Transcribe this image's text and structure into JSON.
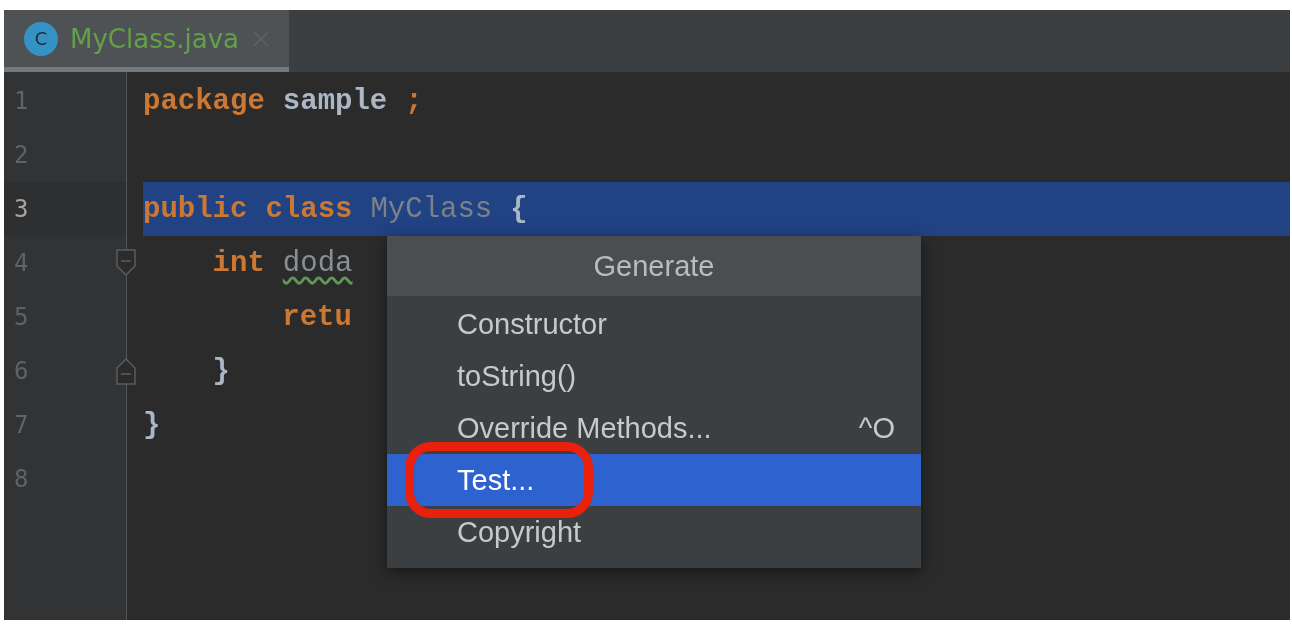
{
  "tabs": [
    {
      "icon_letter": "C",
      "label": "MyClass.java",
      "selected": true
    }
  ],
  "editor": {
    "lines": [
      {
        "number": "1",
        "selected": false,
        "fold_open": false,
        "fold_close": false,
        "tokens": [
          {
            "text": "package",
            "kind": "keyword"
          },
          {
            "text": "sample",
            "kind": "plain"
          },
          {
            "text": ";",
            "kind": "keyword"
          }
        ]
      },
      {
        "number": "2",
        "selected": false,
        "fold_open": false,
        "fold_close": false
      },
      {
        "number": "3",
        "selected": true,
        "fold_open": false,
        "fold_close": false,
        "tokens": [
          {
            "text": "public",
            "kind": "keyword"
          },
          {
            "text": "class",
            "kind": "keyword"
          },
          {
            "text": "MyClass",
            "kind": "classname"
          },
          {
            "text": "{",
            "kind": "plain"
          }
        ]
      },
      {
        "number": "4",
        "selected": false,
        "fold_open": true,
        "fold_close": false,
        "tokens": [
          {
            "text": "    int",
            "kind": "keyword"
          },
          {
            "text": "doda",
            "kind": "warning"
          }
        ]
      },
      {
        "number": "5",
        "selected": false,
        "fold_open": false,
        "fold_close": false,
        "tokens": [
          {
            "text": "        retu",
            "kind": "keyword"
          }
        ]
      },
      {
        "number": "6",
        "selected": false,
        "fold_open": false,
        "fold_close": true,
        "tokens": [
          {
            "text": "    }",
            "kind": "plain"
          }
        ]
      },
      {
        "number": "7",
        "selected": false,
        "fold_open": false,
        "fold_close": false,
        "tokens": [
          {
            "text": "}",
            "kind": "plain"
          }
        ]
      },
      {
        "number": "8",
        "selected": false,
        "fold_open": false,
        "fold_close": false
      }
    ]
  },
  "popup": {
    "title": "Generate",
    "items": [
      {
        "label": "Constructor",
        "selected": false,
        "circled": false
      },
      {
        "label": "toString()",
        "selected": false,
        "circled": false
      },
      {
        "label": "Override Methods...",
        "shortcut": "^O",
        "selected": false,
        "circled": false
      },
      {
        "label": "Test...",
        "selected": true,
        "circled": true
      },
      {
        "label": "Copyright",
        "selected": false,
        "circled": false
      }
    ]
  }
}
